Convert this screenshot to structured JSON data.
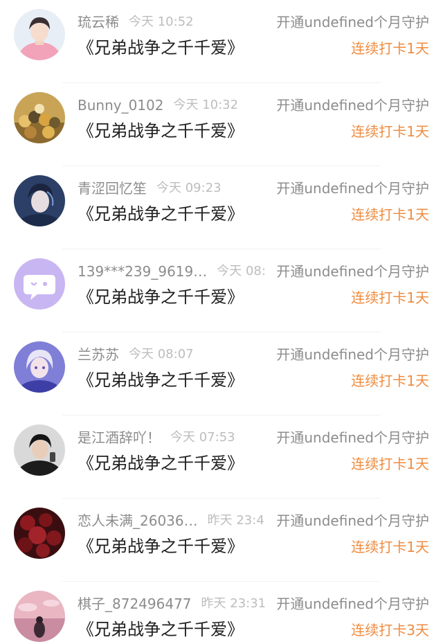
{
  "items": [
    {
      "username": "琉云稀",
      "time": "今天 10:52",
      "action": "开通undefined个月守护",
      "title": "《兄弟战争之千千爱》",
      "streak": "连续打卡1天",
      "avatar": "avatar-pink-outfit"
    },
    {
      "username": "Bunny_0102",
      "time": "今天 10:32",
      "action": "开通undefined个月守护",
      "title": "《兄弟战争之千千爱》",
      "streak": "连续打卡1天",
      "avatar": "avatar-cartoon-group"
    },
    {
      "username": "青涩回忆笙",
      "time": "今天 09:23",
      "action": "开通undefined个月守护",
      "title": "《兄弟战争之千千爱》",
      "streak": "连续打卡1天",
      "avatar": "avatar-anime-boy"
    },
    {
      "username": "139***239_9619…",
      "time": "今天 08:",
      "action": "开通undefined个月守护",
      "title": "《兄弟战争之千千爱》",
      "streak": "连续打卡1天",
      "avatar": "avatar-default-chat"
    },
    {
      "username": "兰苏苏",
      "time": "今天 08:07",
      "action": "开通undefined个月守护",
      "title": "《兄弟战争之千千爱》",
      "streak": "连续打卡1天",
      "avatar": "avatar-anime-silver-hair"
    },
    {
      "username": "是江酒辞吖！",
      "time": "今天 07:53",
      "action": "开通undefined个月守护",
      "title": "《兄弟战争之千千爱》",
      "streak": "连续打卡1天",
      "avatar": "avatar-photo-boy"
    },
    {
      "username": "恋人未满_26036…",
      "time": "昨天 23:4",
      "action": "开通undefined个月守护",
      "title": "《兄弟战争之千千爱》",
      "streak": "连续打卡1天",
      "avatar": "avatar-red-roses"
    },
    {
      "username": "棋子_872496477",
      "time": "昨天 23:31",
      "action": "开通undefined个月守护",
      "title": "《兄弟战争之千千爱》",
      "streak": "连续打卡3天",
      "avatar": "avatar-pink-sky"
    }
  ],
  "colors": {
    "streak": "#f08b3e",
    "secondary_text": "#8c8c8c",
    "time_text": "#bdbdbd",
    "primary_text": "#1f1f1f"
  }
}
